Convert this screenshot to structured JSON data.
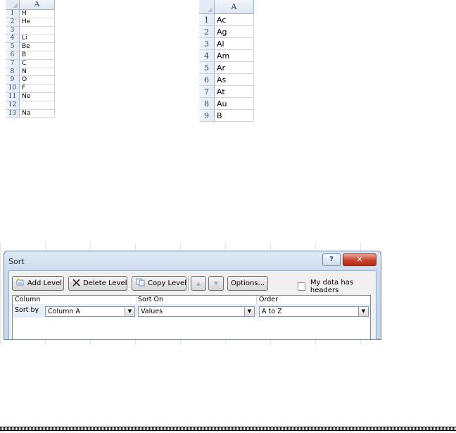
{
  "sheet_left": {
    "column_header": "A",
    "rows": [
      {
        "num": "1",
        "value": "H"
      },
      {
        "num": "2",
        "value": "He"
      },
      {
        "num": "3",
        "value": ""
      },
      {
        "num": "4",
        "value": "Li"
      },
      {
        "num": "5",
        "value": "Be"
      },
      {
        "num": "6",
        "value": "B"
      },
      {
        "num": "7",
        "value": "C"
      },
      {
        "num": "8",
        "value": "N"
      },
      {
        "num": "9",
        "value": "O"
      },
      {
        "num": "10",
        "value": "F"
      },
      {
        "num": "11",
        "value": "Ne"
      },
      {
        "num": "12",
        "value": ""
      },
      {
        "num": "13",
        "value": "Na"
      }
    ]
  },
  "sheet_right": {
    "column_header": "A",
    "rows": [
      {
        "num": "1",
        "value": "Ac"
      },
      {
        "num": "2",
        "value": "Ag"
      },
      {
        "num": "3",
        "value": "Al"
      },
      {
        "num": "4",
        "value": "Am"
      },
      {
        "num": "5",
        "value": "Ar"
      },
      {
        "num": "6",
        "value": "As"
      },
      {
        "num": "7",
        "value": "At"
      },
      {
        "num": "8",
        "value": "Au"
      },
      {
        "num": "9",
        "value": "B"
      }
    ]
  },
  "dialog": {
    "title": "Sort",
    "help_label": "?",
    "close_label": "✕",
    "toolbar": {
      "add_level": "Add Level",
      "delete_level": "Delete Level",
      "copy_level": "Copy Level",
      "move_up": "▲",
      "move_down": "▼",
      "options": "Options..."
    },
    "headers_checkbox_label": "My data has headers",
    "headers_checked": false,
    "grid": {
      "col_column": "Column",
      "col_sort_on": "Sort On",
      "col_order": "Order"
    },
    "level": {
      "label": "Sort by",
      "column": "Column A",
      "sort_on": "Values",
      "order": "A to Z"
    }
  },
  "icons": {
    "add_level": "add-level-icon",
    "delete_level": "delete-x-icon",
    "copy_level": "copy-icon",
    "dropdown": "chevron-down-icon"
  },
  "colors": {
    "sheet_header_bg": "#dde6f1",
    "close_button": "#c8402a",
    "dialog_frame": "#c5d6eb"
  }
}
